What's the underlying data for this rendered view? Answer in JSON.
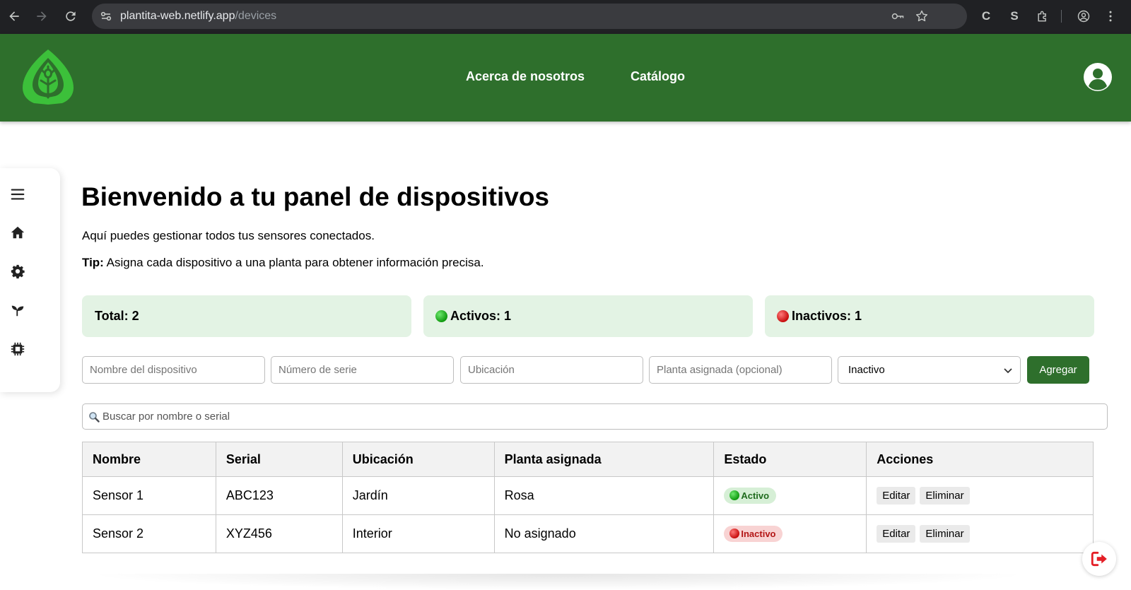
{
  "browser": {
    "url_host": "plantita-web.netlify.app",
    "url_path": "/devices"
  },
  "header": {
    "nav": [
      "Acerca de nosotros",
      "Catálogo"
    ]
  },
  "sidebar": {
    "items": [
      "menu-icon",
      "home-icon",
      "settings-icon",
      "sprout-icon",
      "chip-icon"
    ]
  },
  "main": {
    "title": "Bienvenido a tu panel de dispositivos",
    "subtitle": "Aquí puedes gestionar todos tus sensores conectados.",
    "tip_label": "Tip:",
    "tip_text": " Asigna cada dispositivo a una planta para obtener información precisa."
  },
  "stats": {
    "total": "Total: 2",
    "active": "Activos: 1",
    "inactive": "Inactivos: 1"
  },
  "form": {
    "name_placeholder": "Nombre del dispositivo",
    "serial_placeholder": "Número de serie",
    "location_placeholder": "Ubicación",
    "plant_placeholder": "Planta asignada (opcional)",
    "status_value": "Inactivo",
    "add_label": "Agregar"
  },
  "search": {
    "placeholder": "Buscar por nombre o serial"
  },
  "table": {
    "headers": [
      "Nombre",
      "Serial",
      "Ubicación",
      "Planta asignada",
      "Estado",
      "Acciones"
    ],
    "rows": [
      {
        "name": "Sensor 1",
        "serial": "ABC123",
        "location": "Jardín",
        "plant": "Rosa",
        "status": "Activo"
      },
      {
        "name": "Sensor 2",
        "serial": "XYZ456",
        "location": "Interior",
        "plant": "No asignado",
        "status": "Inactivo"
      }
    ],
    "edit_label": "Editar",
    "delete_label": "Eliminar"
  },
  "colors": {
    "brand_green": "#2e6f2c",
    "stat_bg": "#e3f3e4",
    "active": "#0f9a0f",
    "inactive": "#c70d0d"
  }
}
